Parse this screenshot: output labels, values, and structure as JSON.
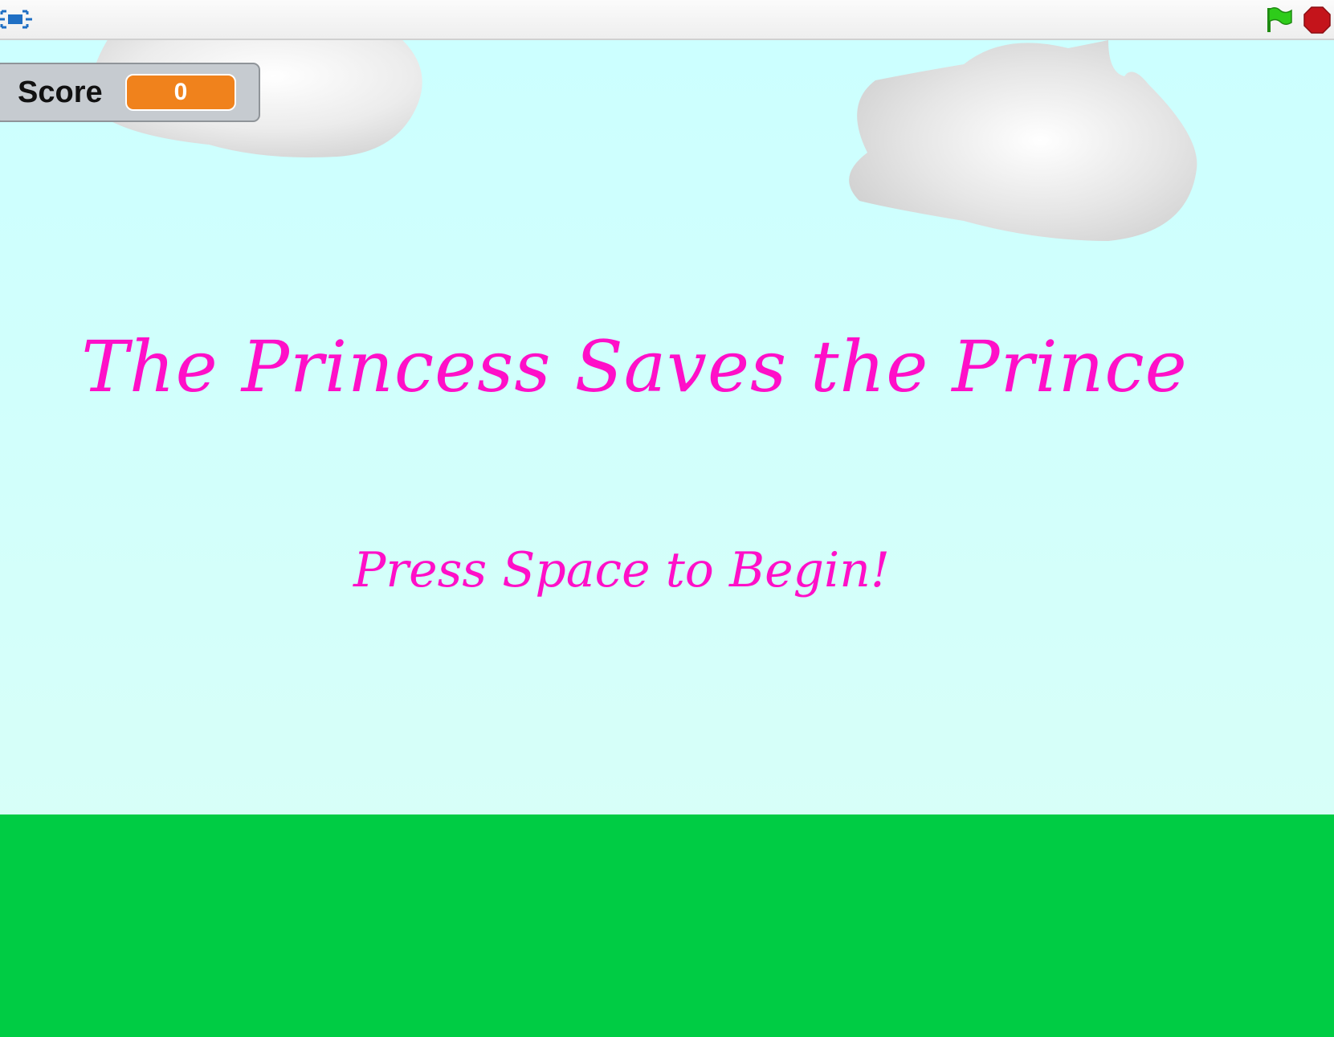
{
  "toolbar": {
    "fullscreen_icon": "fullscreen-icon",
    "green_flag_icon": "green-flag-icon",
    "stop_icon": "stop-sign-icon",
    "flag_color": "#2ecc1a",
    "stop_color": "#c4141b"
  },
  "stage": {
    "sky_color": "#ccffff",
    "ground_color": "#00cc44",
    "title": "The Princess Saves the Prince",
    "prompt": "Press Space to Begin!",
    "text_color": "#ff0fc8"
  },
  "score_monitor": {
    "label": "Score",
    "value": "0",
    "value_color": "#f0821c"
  }
}
